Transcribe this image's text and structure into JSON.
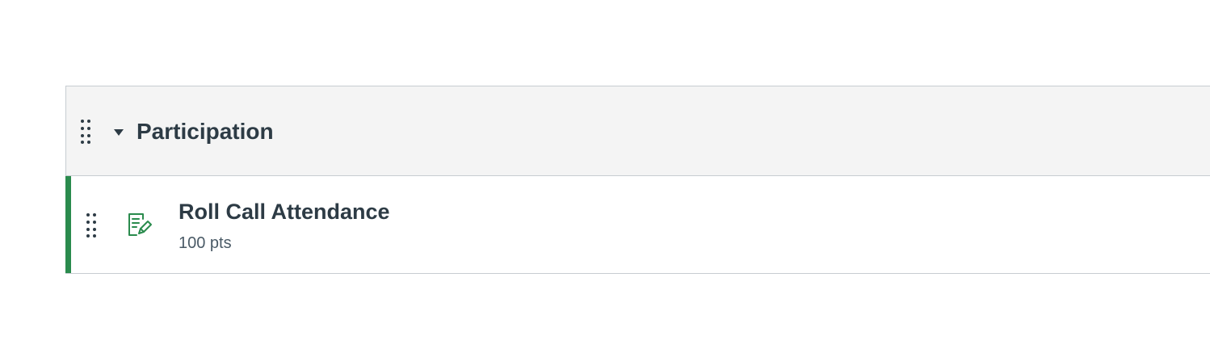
{
  "group": {
    "title": "Participation"
  },
  "items": [
    {
      "title": "Roll Call Attendance",
      "points": "100 pts",
      "icon": "assignment-icon",
      "status_color": "#2a8b4d"
    }
  ],
  "colors": {
    "header_bg": "#f4f4f4",
    "border": "#c7cdd1",
    "text": "#2d3b45",
    "published": "#2a8b4d"
  }
}
